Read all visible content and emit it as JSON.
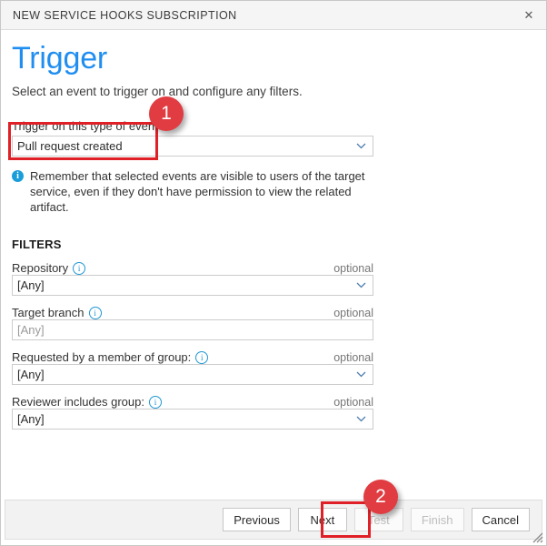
{
  "window": {
    "title": "NEW SERVICE HOOKS SUBSCRIPTION",
    "close_icon": "✕"
  },
  "page": {
    "title": "Trigger",
    "subtitle": "Select an event to trigger on and configure any filters."
  },
  "trigger": {
    "label": "Trigger on this type of event",
    "value": "Pull request created",
    "chevron_icon": "chevron-down-icon"
  },
  "notice": {
    "icon": "info-icon",
    "text": "Remember that selected events are visible to users of the target service, even if they don't have permission to view the related artifact."
  },
  "filters": {
    "heading": "FILTERS",
    "optional_label": "optional",
    "info_icon": "info-icon",
    "items": [
      {
        "label": "Repository",
        "value": "[Any]",
        "type": "combo",
        "placeholder": "[Any]"
      },
      {
        "label": "Target branch",
        "value": "[Any]",
        "type": "text",
        "placeholder": "[Any]"
      },
      {
        "label": "Requested by a member of group:",
        "value": "[Any]",
        "type": "combo",
        "placeholder": "[Any]"
      },
      {
        "label": "Reviewer includes group:",
        "value": "[Any]",
        "type": "combo",
        "placeholder": "[Any]"
      }
    ]
  },
  "footer": {
    "buttons": [
      {
        "label": "Previous",
        "enabled": true
      },
      {
        "label": "Next",
        "enabled": true
      },
      {
        "label": "Test",
        "enabled": false
      },
      {
        "label": "Finish",
        "enabled": false
      },
      {
        "label": "Cancel",
        "enabled": true
      }
    ],
    "resize_grip_icon": "resize-grip-icon"
  },
  "annotations": {
    "badge_one": "1",
    "badge_two": "2",
    "highlight_color": "#e02027",
    "badge_color": "#e03c42"
  }
}
